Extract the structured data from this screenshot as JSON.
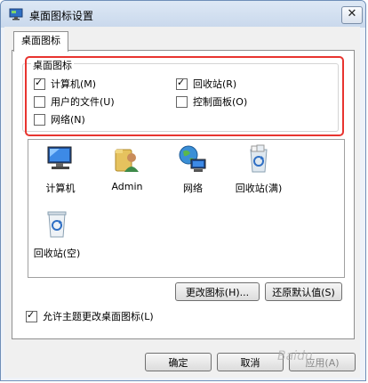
{
  "window": {
    "title": "桌面图标设置",
    "close_label": "✕"
  },
  "tabs": [
    {
      "label": "桌面图标"
    }
  ],
  "group": {
    "label": "桌面图标",
    "checkboxes": [
      {
        "label": "计算机(M)",
        "checked": true
      },
      {
        "label": "回收站(R)",
        "checked": true
      },
      {
        "label": "用户的文件(U)",
        "checked": false
      },
      {
        "label": "控制面板(O)",
        "checked": false
      },
      {
        "label": "网络(N)",
        "checked": false
      }
    ]
  },
  "icons": [
    {
      "label": "计算机",
      "icon": "computer-icon"
    },
    {
      "label": "Admin",
      "icon": "user-folder-icon"
    },
    {
      "label": "网络",
      "icon": "network-icon"
    },
    {
      "label": "回收站(满)",
      "icon": "recycle-bin-full-icon"
    },
    {
      "label": "回收站(空)",
      "icon": "recycle-bin-empty-icon"
    }
  ],
  "buttons": {
    "change_icon": "更改图标(H)...",
    "restore_default": "还原默认值(S)",
    "ok": "确定",
    "cancel": "取消",
    "apply": "应用(A)"
  },
  "allow_themes": {
    "label": "允许主题更改桌面图标(L)",
    "checked": true
  },
  "watermark": "Baidu"
}
